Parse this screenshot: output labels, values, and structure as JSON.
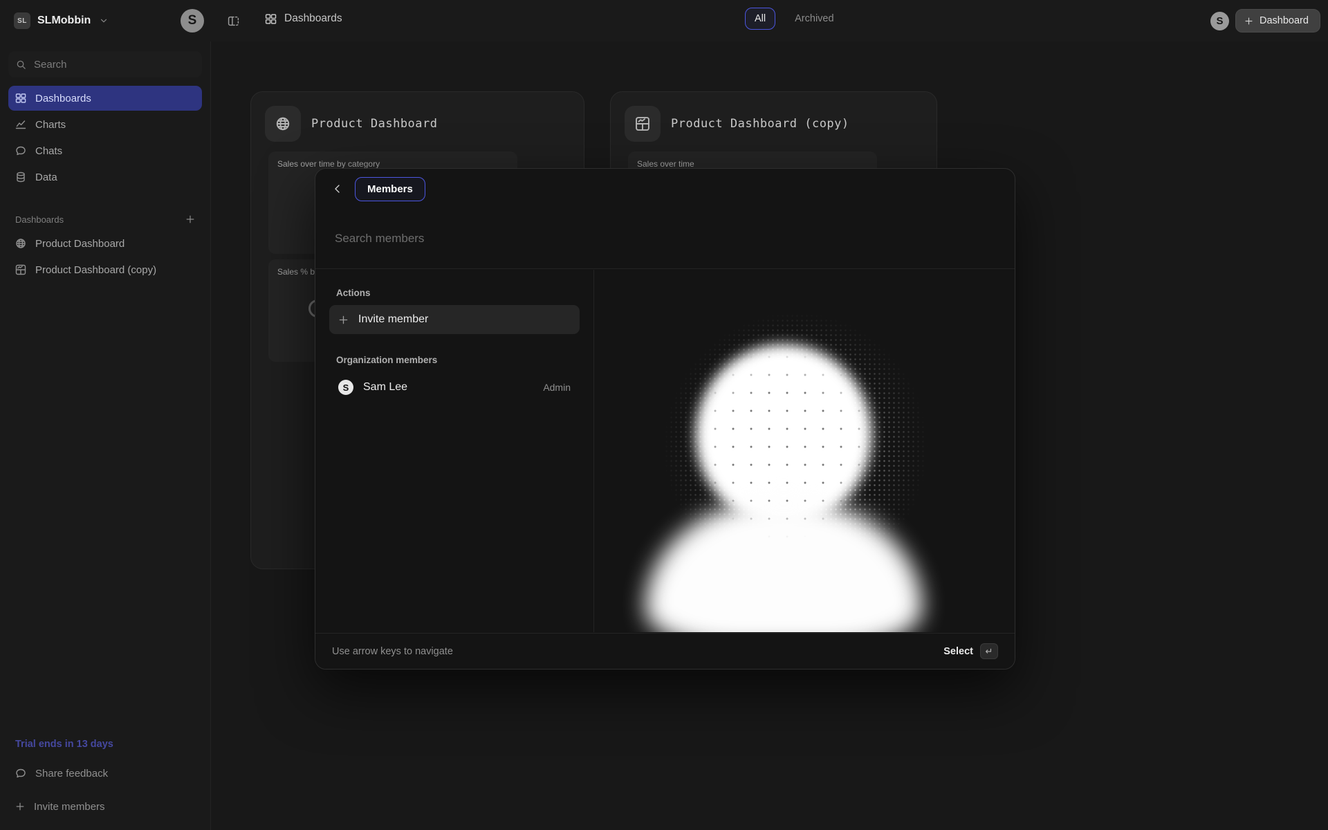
{
  "colors": {
    "accent": "#4c56e0",
    "active_nav_bg": "#2e3480",
    "trial_text": "#45489f"
  },
  "topbar": {
    "workspace_initials": "SL",
    "workspace_name": "SLMobbin",
    "logo_letter": "S",
    "breadcrumb": "Dashboards",
    "tabs": [
      {
        "label": "All"
      },
      {
        "label": "Archived"
      }
    ],
    "user_initial": "S",
    "new_dashboard_label": "Dashboard"
  },
  "sidebar": {
    "search_placeholder": "Search",
    "nav": [
      {
        "label": "Dashboards"
      },
      {
        "label": "Charts"
      },
      {
        "label": "Chats"
      },
      {
        "label": "Data"
      }
    ],
    "section_title": "Dashboards",
    "dashboards": [
      {
        "label": "Product Dashboard"
      },
      {
        "label": "Product Dashboard (copy)"
      }
    ],
    "trial_note": "Trial ends in 13 days",
    "share_feedback": "Share feedback",
    "invite_members": "Invite members"
  },
  "cards": [
    {
      "title": "Product Dashboard",
      "previews": [
        {
          "label": "Sales over time by category"
        },
        {
          "label": "Sales % by C"
        }
      ]
    },
    {
      "title": "Product Dashboard (copy)",
      "previews": [
        {
          "label": "Sales over time"
        }
      ]
    }
  ],
  "modal": {
    "tab_label": "Members",
    "search_placeholder": "Search members",
    "actions_label": "Actions",
    "invite_action": "Invite member",
    "org_members_label": "Organization members",
    "members": [
      {
        "initial": "S",
        "name": "Sam Lee",
        "role": "Admin"
      }
    ],
    "footer_hint": "Use arrow keys to navigate",
    "select_label": "Select",
    "enter_symbol": "↵"
  }
}
